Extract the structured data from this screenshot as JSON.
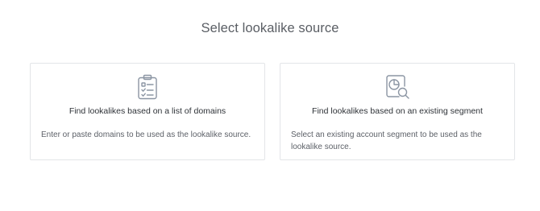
{
  "page": {
    "title": "Select lookalike source"
  },
  "cards": [
    {
      "icon": "clipboard-checklist-icon",
      "title": "Find lookalikes based on a list of domains",
      "description": "Enter or paste domains to be used as the lookalike source."
    },
    {
      "icon": "segment-search-icon",
      "title": "Find lookalikes based on an existing segment",
      "description": "Select an existing account segment to be used as the lookalike source."
    }
  ],
  "colors": {
    "icon": "#8b95a3",
    "border": "#e3e5e8",
    "title_text": "#5a5e64"
  }
}
